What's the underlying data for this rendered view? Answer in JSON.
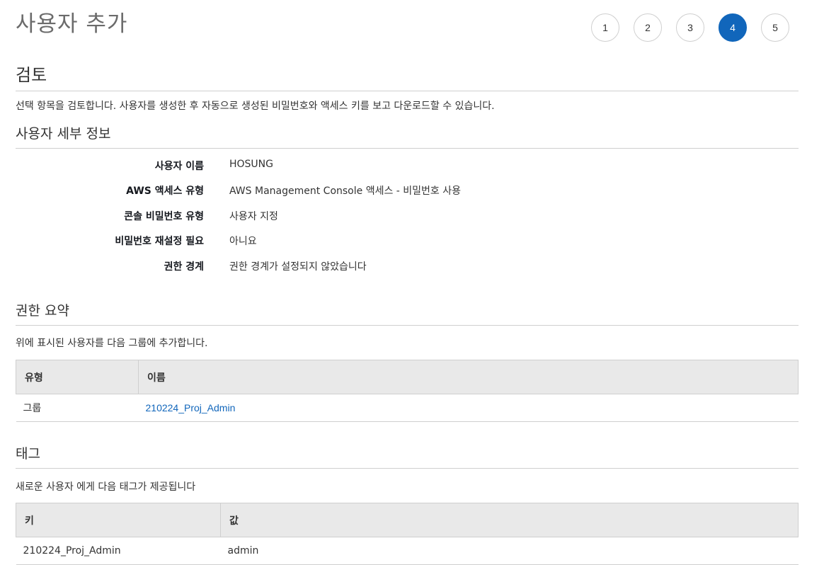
{
  "page_title": "사용자 추가",
  "steps": [
    "1",
    "2",
    "3",
    "4",
    "5"
  ],
  "active_step": "4",
  "review": {
    "heading": "검토",
    "description": "선택 항목을 검토합니다. 사용자를 생성한 후 자동으로 생성된 비밀번호와 액세스 키를 보고 다운로드할 수 있습니다."
  },
  "user_details": {
    "heading": "사용자 세부 정보",
    "rows": [
      {
        "label": "사용자 이름",
        "value": "HOSUNG"
      },
      {
        "label": "AWS 액세스 유형",
        "value": "AWS Management Console 액세스 - 비밀번호 사용"
      },
      {
        "label": "콘솔 비밀번호 유형",
        "value": "사용자 지정"
      },
      {
        "label": "비밀번호 재설정 필요",
        "value": "아니요"
      },
      {
        "label": "권한 경계",
        "value": "권한 경계가 설정되지 않았습니다"
      }
    ]
  },
  "permissions": {
    "heading": "권한 요약",
    "description": "위에 표시된 사용자를 다음 그룹에 추가합니다.",
    "columns": [
      "유형",
      "이름"
    ],
    "rows": [
      {
        "type": "그룹",
        "name": "210224_Proj_Admin"
      }
    ]
  },
  "tags": {
    "heading": "태그",
    "description": "새로운 사용자 에게 다음 태그가 제공됩니다",
    "columns": [
      "키",
      "값"
    ],
    "rows": [
      {
        "key": "210224_Proj_Admin",
        "value": "admin"
      }
    ]
  },
  "colors": {
    "accent": "#1166bb",
    "header_bg": "#e9e9e9",
    "border": "#cfcfcf"
  }
}
